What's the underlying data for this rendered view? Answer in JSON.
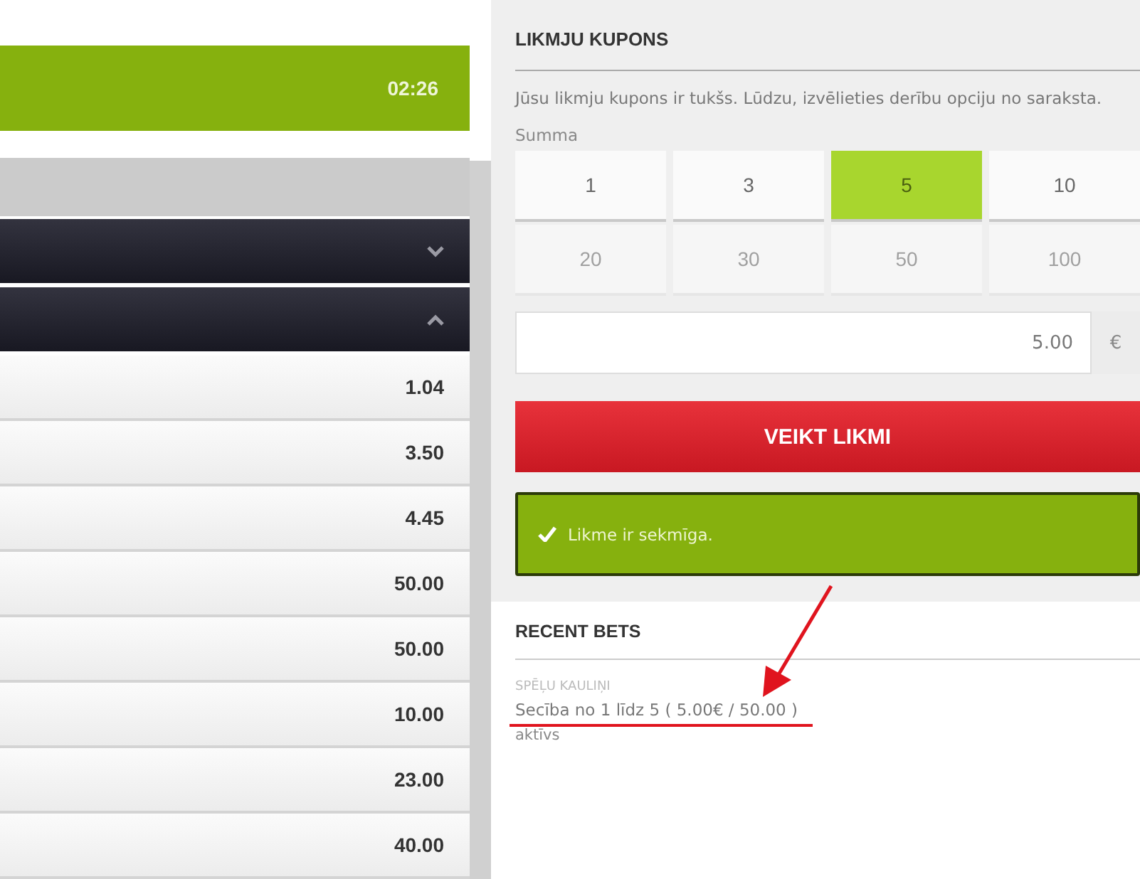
{
  "match_bar": {
    "time": "02:26"
  },
  "market_groups": [
    {
      "expanded": false
    },
    {
      "expanded": true
    }
  ],
  "odds": [
    "1.04",
    "3.50",
    "4.45",
    "50.00",
    "50.00",
    "10.00",
    "23.00",
    "40.00"
  ],
  "bet_slip": {
    "title": "LIKMJU KUPONS",
    "message": "Jūsu likmju kupons ir tukšs. Lūdzu, izvēlieties derību opciju no saraksta.",
    "amount_label": "Summa",
    "amounts": [
      {
        "label": "1",
        "selected": false,
        "disabled": false
      },
      {
        "label": "3",
        "selected": false,
        "disabled": false
      },
      {
        "label": "5",
        "selected": true,
        "disabled": false
      },
      {
        "label": "10",
        "selected": false,
        "disabled": false
      },
      {
        "label": "20",
        "selected": false,
        "disabled": true
      },
      {
        "label": "30",
        "selected": false,
        "disabled": true
      },
      {
        "label": "50",
        "selected": false,
        "disabled": true
      },
      {
        "label": "100",
        "selected": false,
        "disabled": true
      }
    ],
    "stake_value": "5.00",
    "currency": "€",
    "place_bet_button": "VEIKT LIKMI",
    "success_message": "Likme ir sekmīga."
  },
  "recent_bets": {
    "title": "RECENT BETS",
    "bets": [
      {
        "game": "SPĒĻU KAULIŅI",
        "description": "Secība no 1 līdz 5 ( 5.00€ / 50.00 )",
        "status": "aktīvs"
      }
    ]
  }
}
